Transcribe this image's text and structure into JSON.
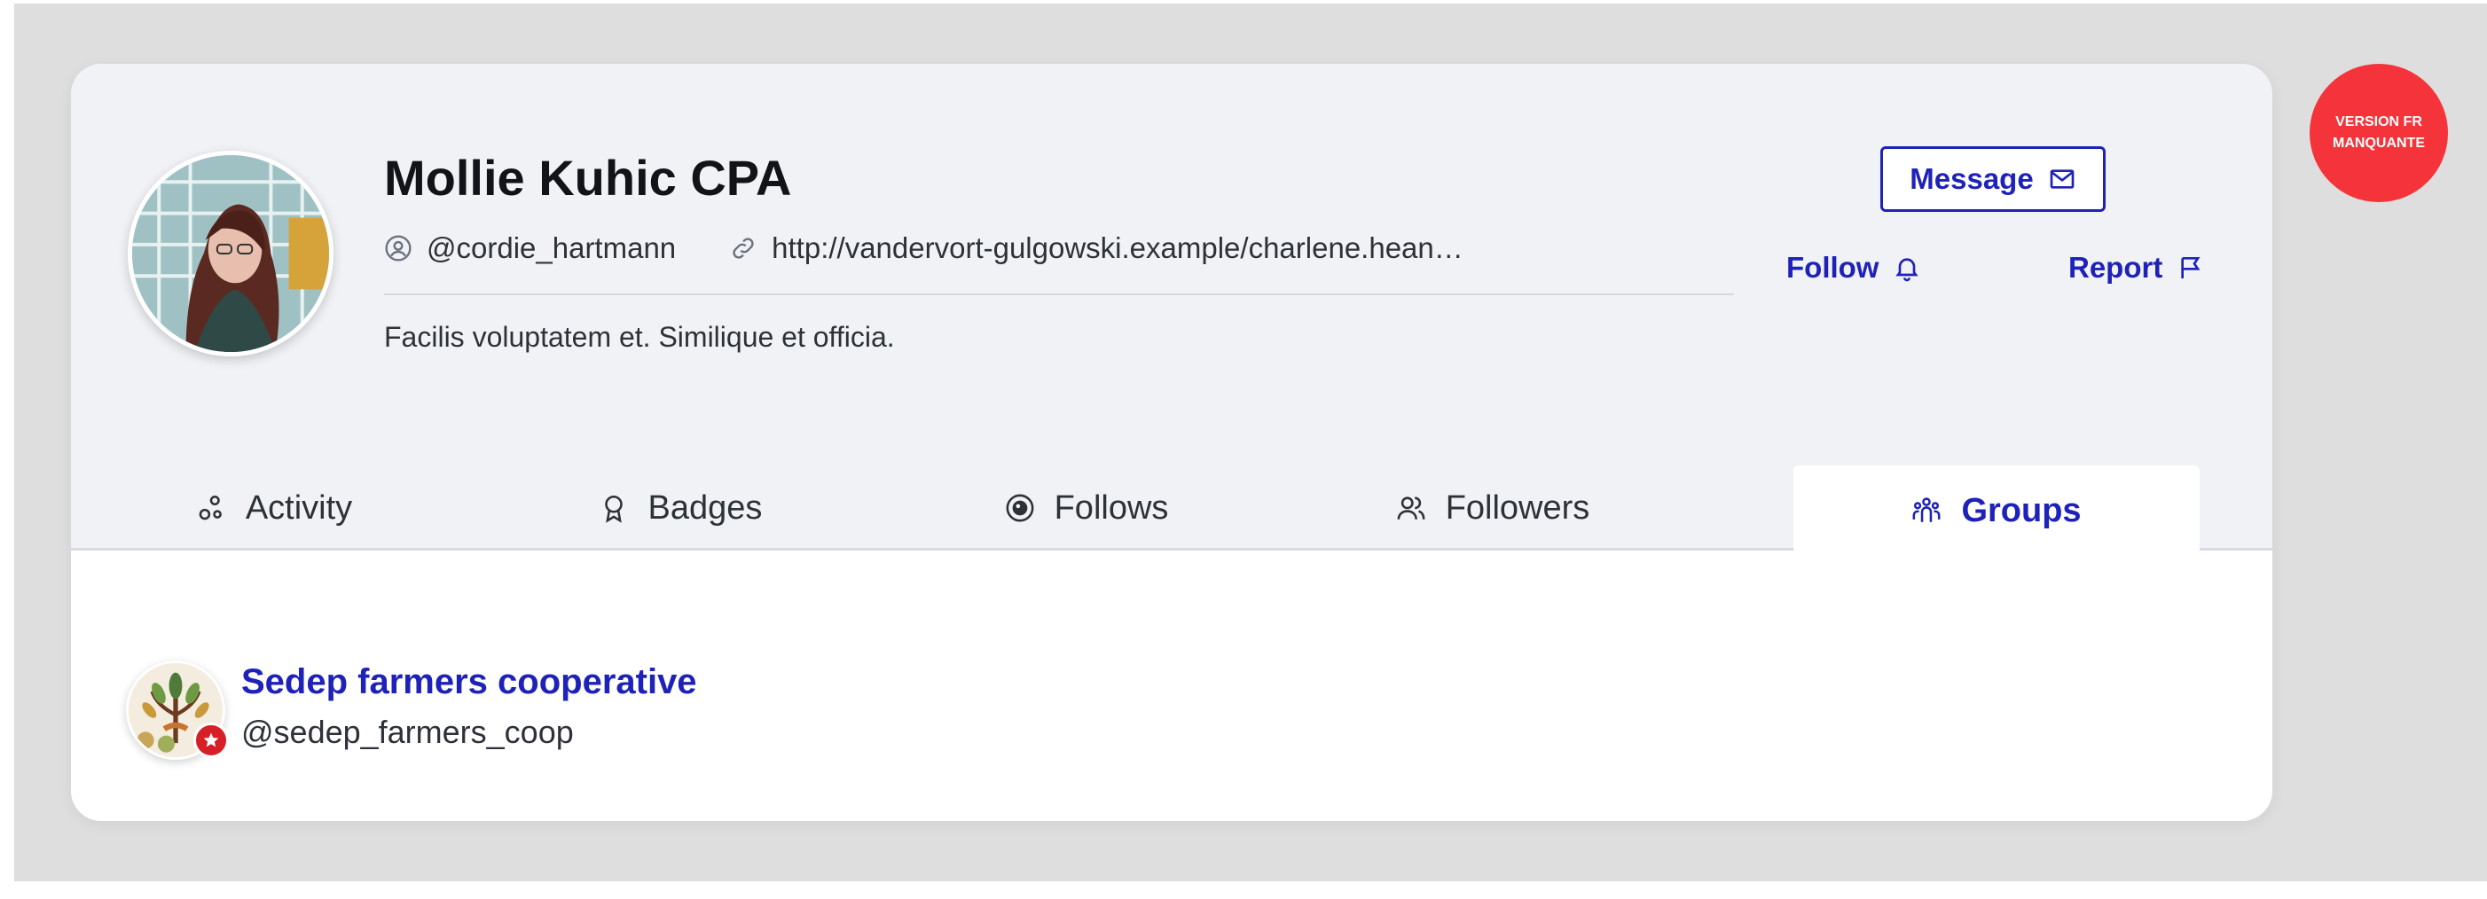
{
  "profile": {
    "name": "Mollie Kuhic CPA",
    "handle": "@cordie_hartmann",
    "website": "http://vandervort-gulgowski.example/charlene.heaney",
    "bio": "Facilis voluptatem et. Similique et officia.",
    "avatar_icon": "user-photo"
  },
  "actions": {
    "message_label": "Message",
    "message_icon": "envelope-icon",
    "follow_label": "Follow",
    "follow_icon": "bell-icon",
    "report_label": "Report",
    "report_icon": "flag-icon"
  },
  "tabs": [
    {
      "label": "Activity",
      "icon": "activity-icon",
      "active": false
    },
    {
      "label": "Badges",
      "icon": "badge-icon",
      "active": false
    },
    {
      "label": "Follows",
      "icon": "eye-icon",
      "active": false
    },
    {
      "label": "Followers",
      "icon": "users-icon",
      "active": false
    },
    {
      "label": "Groups",
      "icon": "group-icon",
      "active": true
    }
  ],
  "groups": [
    {
      "name": "Sedep farmers cooperative",
      "handle": "@sedep_farmers_coop",
      "badge_icon": "star-icon"
    }
  ],
  "version_badge": {
    "line1": "VERSION FR",
    "line2": "MANQUANTE"
  },
  "colors": {
    "accent": "#1e22b8",
    "card_bg": "#f1f2f5",
    "page_bg": "#dedede",
    "badge_red": "#f5333a"
  }
}
